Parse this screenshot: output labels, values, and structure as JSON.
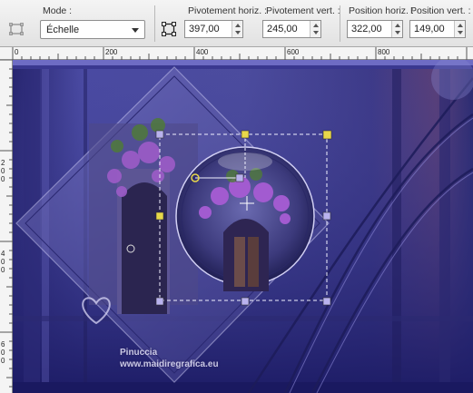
{
  "toolbar": {
    "mode": {
      "label": "Mode :",
      "value": "Échelle"
    },
    "pivot_h": {
      "label": "Pivotement horiz. :",
      "value": "397,00"
    },
    "pivot_v": {
      "label": "Pivotement vert. :",
      "value": "245,00"
    },
    "pos_h": {
      "label": "Position horiz. :",
      "value": "322,00"
    },
    "pos_v": {
      "label": "Position vert. :",
      "value": "149,00"
    }
  },
  "ruler": {
    "top_labels": [
      "0",
      "200",
      "400",
      "600",
      "800"
    ],
    "left_labels": [
      "2",
      "0",
      "0",
      "4",
      "0",
      "0",
      "6",
      "0",
      "0"
    ]
  },
  "watermark": {
    "line1": "Pinuccia",
    "line2": "www.maidiregrafica.eu"
  },
  "colors": {
    "canvas_bg": "#3a3a8a",
    "handle_yellow": "#e8d84a",
    "handle_lilac": "#b9b2ee"
  }
}
